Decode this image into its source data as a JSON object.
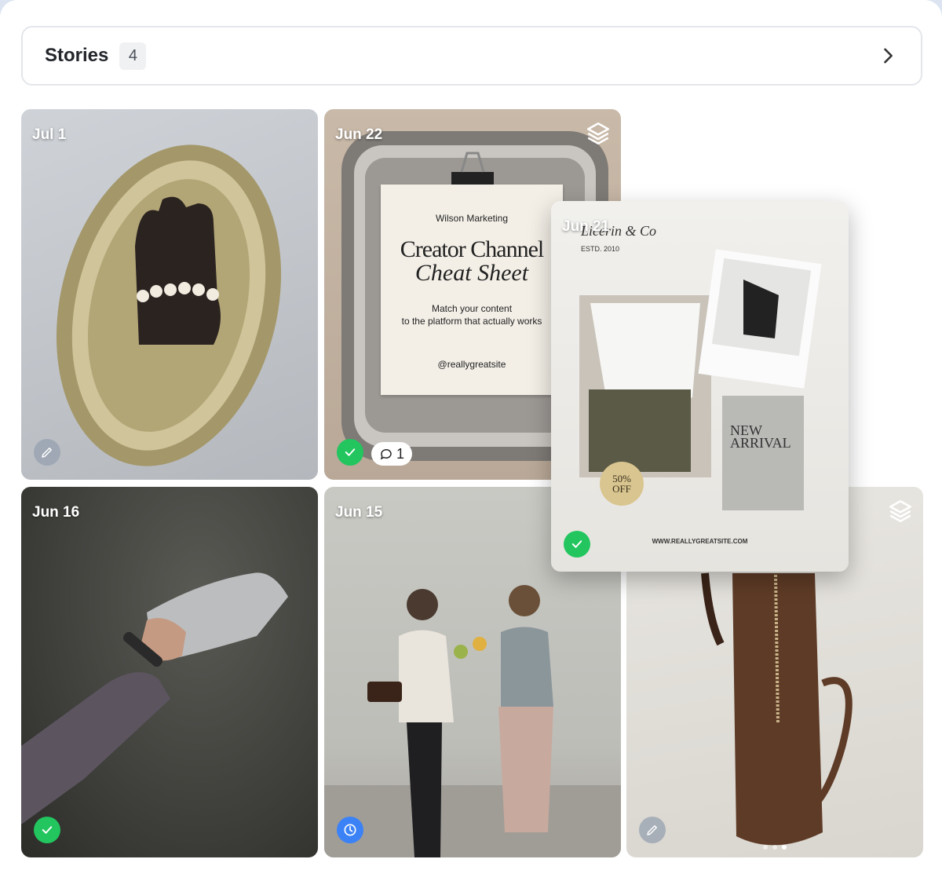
{
  "header": {
    "title": "Stories",
    "count": "4"
  },
  "stories": [
    {
      "date": "Jul 1",
      "status": "draft",
      "status_icon": "pencil-icon"
    },
    {
      "date": "Jun 22",
      "status": "published",
      "status_icon": "check-icon",
      "comments": "1",
      "multi": true
    },
    {
      "date": "Jun 21",
      "status": "published",
      "status_icon": "check-icon"
    },
    {
      "date": "Jun 16",
      "status": "published",
      "status_icon": "check-icon"
    },
    {
      "date": "Jun 15",
      "status": "scheduled",
      "status_icon": "clock-icon"
    },
    {
      "status": "draft",
      "status_icon": "pencil-icon",
      "multi": true
    }
  ],
  "creative": {
    "brand": "Wilson Marketing",
    "title_line1": "Creator Channel",
    "title_line2": "Cheat Sheet",
    "subtitle_line1": "Match your content",
    "subtitle_line2": "to the platform that actually works",
    "handle": "@reallygreatsite"
  },
  "moodboard": {
    "brand": "Licerin & Co",
    "estd": "ESTD. 2010",
    "new_line1": "NEW",
    "new_line2": "ARRIVAL",
    "discount_line1": "50%",
    "discount_line2": "OFF",
    "url": "WWW.REALLYGREATSITE.COM"
  },
  "colors": {
    "check": "#22c55e",
    "clock": "#3b82f6",
    "edit": "#96a0af"
  }
}
